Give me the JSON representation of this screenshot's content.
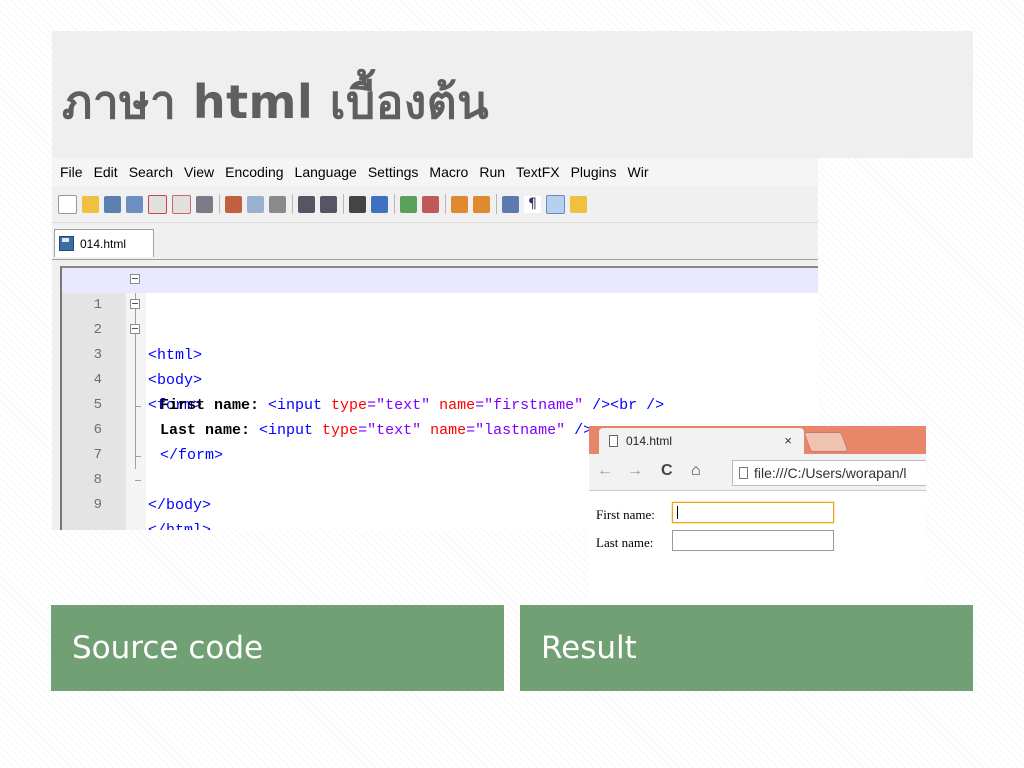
{
  "slide": {
    "title": "ภาษา html เบื้องต้น",
    "captions": {
      "source": "Source code",
      "result": "Result"
    },
    "colors": {
      "caption_bg": "#71a074",
      "title_band": "#efefef",
      "title_text": "#5f5f5f"
    }
  },
  "editor": {
    "menu": [
      "File",
      "Edit",
      "Search",
      "View",
      "Encoding",
      "Language",
      "Settings",
      "Macro",
      "Run",
      "TextFX",
      "Plugins",
      "Wir"
    ],
    "tab_label": "014.html",
    "line_numbers": [
      "1",
      "2",
      "3",
      "4",
      "5",
      "6",
      "7",
      "8",
      "9"
    ],
    "lines": {
      "l1": "<html>",
      "l2": "<body>",
      "l3": "<form>",
      "l4_text": "First name: ",
      "l4_tag_open": "<input ",
      "l4_attr1": "type",
      "l4_val1": "=\"text\" ",
      "l4_attr2": "name",
      "l4_val2": "=\"firstname\" ",
      "l4_tag_close": "/><br />",
      "l5_text": "Last name: ",
      "l5_tag_open": "<input ",
      "l5_attr1": "type",
      "l5_val1": "=\"text\" ",
      "l5_attr2": "name",
      "l5_val2": "=\"lastname\" ",
      "l5_tag_close": "/>",
      "l6": "</form>",
      "l8": "</body>",
      "l9": "</html>"
    },
    "colors": {
      "tag": "#0000ff",
      "attribute": "#ff0000",
      "value": "#8000ff",
      "current_line": "#e8e8ff"
    }
  },
  "browser": {
    "tab_label": "014.html",
    "close_glyph": "×",
    "address": "file:///C:/Users/worapan/l",
    "form": {
      "first_label": "First name:",
      "last_label": "Last name:"
    }
  }
}
